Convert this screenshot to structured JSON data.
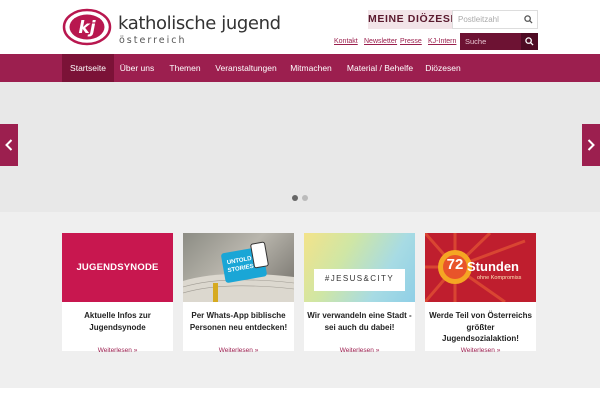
{
  "brand": {
    "logo_mark": "kj",
    "title": "katholische jugend",
    "subtitle": "österreich",
    "color": "#b8174f"
  },
  "header": {
    "diocese_label": "MEINE DIÖZESE:",
    "postcode_placeholder": "Postleitzahl",
    "links": [
      "Kontakt",
      "Newsletter",
      "Presse",
      "KJ-Intern"
    ],
    "search_placeholder": "Suche"
  },
  "nav": {
    "items": [
      "Startseite",
      "Über uns",
      "Themen",
      "Veranstaltungen",
      "Mitmachen",
      "Material / Behelfe",
      "Diözesen"
    ],
    "active": "Startseite",
    "color": "#9c1f4f"
  },
  "slider": {
    "prev_icon": "chevron-left-icon",
    "next_icon": "chevron-right-icon",
    "dots": 2,
    "active_dot": 1
  },
  "cards": [
    {
      "image_text": "JUGENDSYNODE",
      "title": "Aktuelle Infos zur Jugendsynode",
      "more": "Weiterlesen »"
    },
    {
      "image_text": "UNTOLD STORIES",
      "title": "Per Whats-App biblische Personen neu entdecken!",
      "more": "Weiterlesen »"
    },
    {
      "image_text": "#JESUS&CITY",
      "title": "Wir verwandeln eine Stadt - sei auch du dabei!",
      "more": "Weiterlesen »"
    },
    {
      "image_text_1": "72",
      "image_text_2": "Stunden",
      "image_text_3": "ohne Kompromiss",
      "title": "Werde Teil von Österreichs größter Jugendsozialaktion!",
      "more": "Weiterlesen »"
    }
  ]
}
